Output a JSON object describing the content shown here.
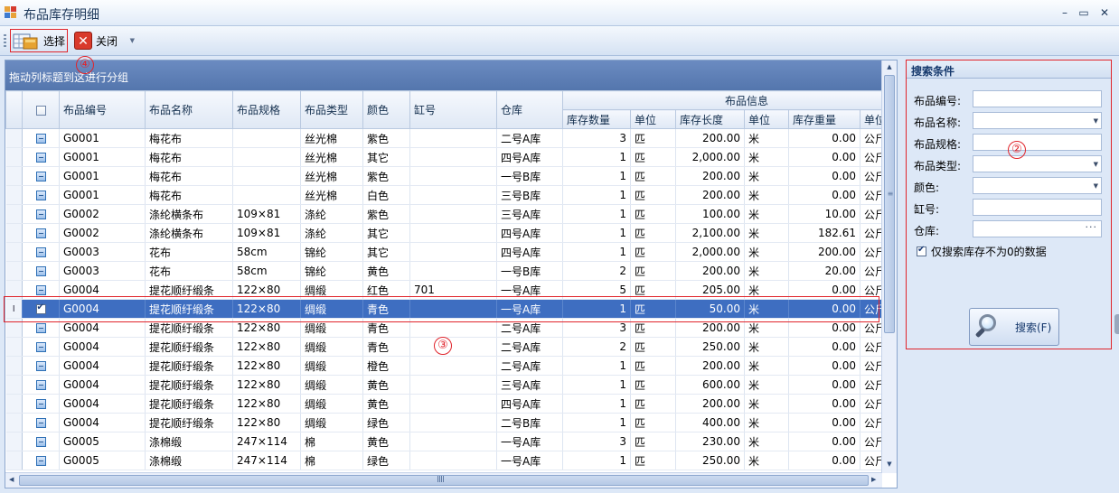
{
  "window": {
    "title": "布品库存明细",
    "controls": [
      "–",
      "▭",
      "✕"
    ]
  },
  "toolbar": {
    "select_label": "选择",
    "close_label": "关闭"
  },
  "grid": {
    "group_panel_text": "拖动列标题到这进行分组",
    "band_label": "布品信息",
    "columns": [
      "布品编号",
      "布品名称",
      "布品规格",
      "布品类型",
      "颜色",
      "缸号",
      "仓库",
      "库存数量",
      "单位",
      "库存长度",
      "单位",
      "库存重量",
      "单位"
    ],
    "rows": [
      {
        "code": "G0001",
        "name": "梅花布",
        "spec": "",
        "type": "丝光棉",
        "color": "紫色",
        "vat": "",
        "wh": "二号A库",
        "qty": "3",
        "u1": "匹",
        "len": "200.00",
        "u2": "米",
        "wt": "0.00",
        "u3": "公斤",
        "checked": false,
        "selected": false
      },
      {
        "code": "G0001",
        "name": "梅花布",
        "spec": "",
        "type": "丝光棉",
        "color": "其它",
        "vat": "",
        "wh": "四号A库",
        "qty": "1",
        "u1": "匹",
        "len": "2,000.00",
        "u2": "米",
        "wt": "0.00",
        "u3": "公斤",
        "checked": false,
        "selected": false
      },
      {
        "code": "G0001",
        "name": "梅花布",
        "spec": "",
        "type": "丝光棉",
        "color": "紫色",
        "vat": "",
        "wh": "一号B库",
        "qty": "1",
        "u1": "匹",
        "len": "200.00",
        "u2": "米",
        "wt": "0.00",
        "u3": "公斤",
        "checked": false,
        "selected": false
      },
      {
        "code": "G0001",
        "name": "梅花布",
        "spec": "",
        "type": "丝光棉",
        "color": "白色",
        "vat": "",
        "wh": "三号B库",
        "qty": "1",
        "u1": "匹",
        "len": "200.00",
        "u2": "米",
        "wt": "0.00",
        "u3": "公斤",
        "checked": false,
        "selected": false
      },
      {
        "code": "G0002",
        "name": "涤纶横条布",
        "spec": "109×81",
        "type": "涤纶",
        "color": "紫色",
        "vat": "",
        "wh": "三号A库",
        "qty": "1",
        "u1": "匹",
        "len": "100.00",
        "u2": "米",
        "wt": "10.00",
        "u3": "公斤",
        "checked": false,
        "selected": false
      },
      {
        "code": "G0002",
        "name": "涤纶横条布",
        "spec": "109×81",
        "type": "涤纶",
        "color": "其它",
        "vat": "",
        "wh": "四号A库",
        "qty": "1",
        "u1": "匹",
        "len": "2,100.00",
        "u2": "米",
        "wt": "182.61",
        "u3": "公斤",
        "checked": false,
        "selected": false
      },
      {
        "code": "G0003",
        "name": "花布",
        "spec": "58cm",
        "type": "锦纶",
        "color": "其它",
        "vat": "",
        "wh": "四号A库",
        "qty": "1",
        "u1": "匹",
        "len": "2,000.00",
        "u2": "米",
        "wt": "200.00",
        "u3": "公斤",
        "checked": false,
        "selected": false
      },
      {
        "code": "G0003",
        "name": "花布",
        "spec": "58cm",
        "type": "锦纶",
        "color": "黄色",
        "vat": "",
        "wh": "一号B库",
        "qty": "2",
        "u1": "匹",
        "len": "200.00",
        "u2": "米",
        "wt": "20.00",
        "u3": "公斤",
        "checked": false,
        "selected": false
      },
      {
        "code": "G0004",
        "name": "提花顺纡缎条",
        "spec": "122×80",
        "type": "绸缎",
        "color": "红色",
        "vat": "701",
        "wh": "一号A库",
        "qty": "5",
        "u1": "匹",
        "len": "205.00",
        "u2": "米",
        "wt": "0.00",
        "u3": "公斤",
        "checked": false,
        "selected": false
      },
      {
        "code": "G0004",
        "name": "提花顺纡缎条",
        "spec": "122×80",
        "type": "绸缎",
        "color": "青色",
        "vat": "",
        "wh": "一号A库",
        "qty": "1",
        "u1": "匹",
        "len": "50.00",
        "u2": "米",
        "wt": "0.00",
        "u3": "公斤",
        "checked": true,
        "selected": true
      },
      {
        "code": "G0004",
        "name": "提花顺纡缎条",
        "spec": "122×80",
        "type": "绸缎",
        "color": "青色",
        "vat": "",
        "wh": "二号A库",
        "qty": "3",
        "u1": "匹",
        "len": "200.00",
        "u2": "米",
        "wt": "0.00",
        "u3": "公斤",
        "checked": false,
        "selected": false
      },
      {
        "code": "G0004",
        "name": "提花顺纡缎条",
        "spec": "122×80",
        "type": "绸缎",
        "color": "青色",
        "vat": "",
        "wh": "二号A库",
        "qty": "2",
        "u1": "匹",
        "len": "250.00",
        "u2": "米",
        "wt": "0.00",
        "u3": "公斤",
        "checked": false,
        "selected": false
      },
      {
        "code": "G0004",
        "name": "提花顺纡缎条",
        "spec": "122×80",
        "type": "绸缎",
        "color": "橙色",
        "vat": "",
        "wh": "二号A库",
        "qty": "1",
        "u1": "匹",
        "len": "200.00",
        "u2": "米",
        "wt": "0.00",
        "u3": "公斤",
        "checked": false,
        "selected": false
      },
      {
        "code": "G0004",
        "name": "提花顺纡缎条",
        "spec": "122×80",
        "type": "绸缎",
        "color": "黄色",
        "vat": "",
        "wh": "三号A库",
        "qty": "1",
        "u1": "匹",
        "len": "600.00",
        "u2": "米",
        "wt": "0.00",
        "u3": "公斤",
        "checked": false,
        "selected": false
      },
      {
        "code": "G0004",
        "name": "提花顺纡缎条",
        "spec": "122×80",
        "type": "绸缎",
        "color": "黄色",
        "vat": "",
        "wh": "四号A库",
        "qty": "1",
        "u1": "匹",
        "len": "200.00",
        "u2": "米",
        "wt": "0.00",
        "u3": "公斤",
        "checked": false,
        "selected": false
      },
      {
        "code": "G0004",
        "name": "提花顺纡缎条",
        "spec": "122×80",
        "type": "绸缎",
        "color": "绿色",
        "vat": "",
        "wh": "二号B库",
        "qty": "1",
        "u1": "匹",
        "len": "400.00",
        "u2": "米",
        "wt": "0.00",
        "u3": "公斤",
        "checked": false,
        "selected": false
      },
      {
        "code": "G0005",
        "name": "涤棉缎",
        "spec": "247×114",
        "type": "棉",
        "color": "黄色",
        "vat": "",
        "wh": "一号A库",
        "qty": "3",
        "u1": "匹",
        "len": "230.00",
        "u2": "米",
        "wt": "0.00",
        "u3": "公斤",
        "checked": false,
        "selected": false
      },
      {
        "code": "G0005",
        "name": "涤棉缎",
        "spec": "247×114",
        "type": "棉",
        "color": "绿色",
        "vat": "",
        "wh": "一号A库",
        "qty": "1",
        "u1": "匹",
        "len": "250.00",
        "u2": "米",
        "wt": "0.00",
        "u3": "公斤",
        "checked": false,
        "selected": false
      }
    ]
  },
  "search_panel": {
    "title": "搜索条件",
    "fields": [
      {
        "label": "布品编号:",
        "kind": "text",
        "value": ""
      },
      {
        "label": "布品名称:",
        "kind": "dropdown",
        "value": ""
      },
      {
        "label": "布品规格:",
        "kind": "text",
        "value": ""
      },
      {
        "label": "布品类型:",
        "kind": "dropdown",
        "value": ""
      },
      {
        "label": "颜色:",
        "kind": "dropdown",
        "value": ""
      },
      {
        "label": "缸号:",
        "kind": "text",
        "value": ""
      },
      {
        "label": "仓库:",
        "kind": "ellipsis",
        "value": ""
      }
    ],
    "checkbox_label": "仅搜索库存不为0的数据",
    "checkbox_checked": true,
    "search_button": "搜索(F)"
  },
  "annotations": [
    "④",
    "②",
    "③"
  ],
  "colors": {
    "selection": "#3e6ec1",
    "annotation": "#e0242b",
    "group_panel": "#5f80b8"
  }
}
